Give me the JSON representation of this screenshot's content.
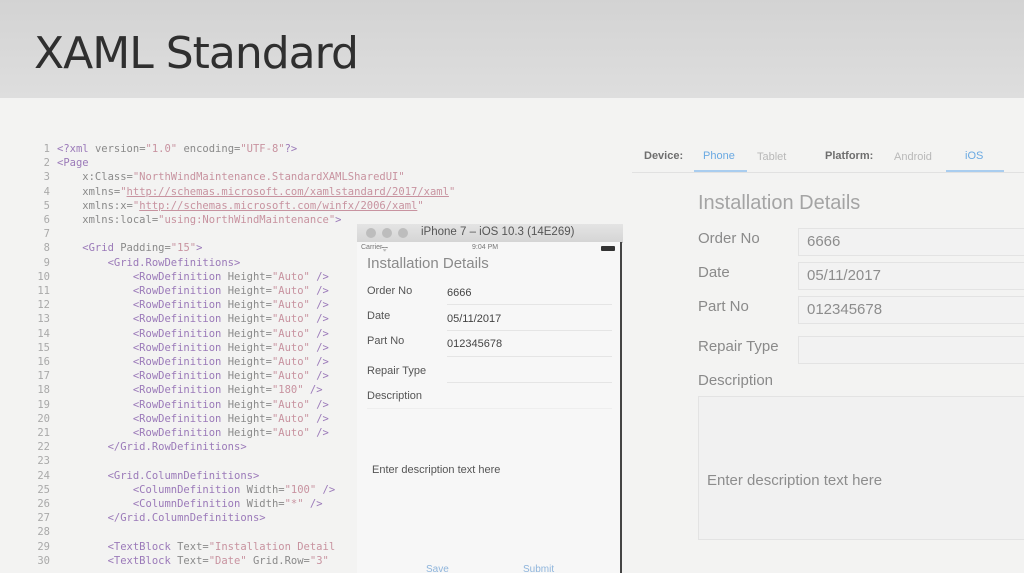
{
  "slide": {
    "title": "XAML Standard"
  },
  "code": {
    "lines": [
      {
        "n": "1",
        "segs": [
          {
            "t": "<?xml ",
            "c": "c-tag"
          },
          {
            "t": "version=",
            "c": "c-attr"
          },
          {
            "t": "\"1.0\"",
            "c": "c-str"
          },
          {
            "t": " encoding=",
            "c": "c-attr"
          },
          {
            "t": "\"UTF-8\"",
            "c": "c-str"
          },
          {
            "t": "?>",
            "c": "c-tag"
          }
        ]
      },
      {
        "n": "2",
        "segs": [
          {
            "t": "<Page",
            "c": "c-tag"
          }
        ]
      },
      {
        "n": "3",
        "segs": [
          {
            "t": "    x:Class=",
            "c": "c-attr"
          },
          {
            "t": "\"NorthWindMaintenance.StandardXAMLSharedUI\"",
            "c": "c-str"
          }
        ]
      },
      {
        "n": "4",
        "segs": [
          {
            "t": "    xmlns=",
            "c": "c-attr"
          },
          {
            "t": "\"",
            "c": "c-str"
          },
          {
            "t": "http://schemas.microsoft.com/xamlstandard/2017/xaml",
            "c": "c-link"
          },
          {
            "t": "\"",
            "c": "c-str"
          }
        ]
      },
      {
        "n": "5",
        "segs": [
          {
            "t": "    xmlns:x=",
            "c": "c-attr"
          },
          {
            "t": "\"",
            "c": "c-str"
          },
          {
            "t": "http://schemas.microsoft.com/winfx/2006/xaml",
            "c": "c-link"
          },
          {
            "t": "\"",
            "c": "c-str"
          }
        ]
      },
      {
        "n": "6",
        "segs": [
          {
            "t": "    xmlns:local=",
            "c": "c-attr"
          },
          {
            "t": "\"using:NorthWindMaintenance\"",
            "c": "c-str"
          },
          {
            "t": ">",
            "c": "c-tag"
          }
        ]
      },
      {
        "n": "7",
        "segs": []
      },
      {
        "n": "8",
        "segs": [
          {
            "t": "    <Grid ",
            "c": "c-tag"
          },
          {
            "t": "Padding=",
            "c": "c-attr"
          },
          {
            "t": "\"15\"",
            "c": "c-str"
          },
          {
            "t": ">",
            "c": "c-tag"
          }
        ]
      },
      {
        "n": "9",
        "segs": [
          {
            "t": "        <Grid.RowDefinitions>",
            "c": "c-tag"
          }
        ]
      },
      {
        "n": "10",
        "segs": [
          {
            "t": "            <RowDefinition ",
            "c": "c-tag"
          },
          {
            "t": "Height=",
            "c": "c-attr"
          },
          {
            "t": "\"Auto\"",
            "c": "c-str"
          },
          {
            "t": " />",
            "c": "c-tag"
          }
        ]
      },
      {
        "n": "11",
        "segs": [
          {
            "t": "            <RowDefinition ",
            "c": "c-tag"
          },
          {
            "t": "Height=",
            "c": "c-attr"
          },
          {
            "t": "\"Auto\"",
            "c": "c-str"
          },
          {
            "t": " />",
            "c": "c-tag"
          }
        ]
      },
      {
        "n": "12",
        "segs": [
          {
            "t": "            <RowDefinition ",
            "c": "c-tag"
          },
          {
            "t": "Height=",
            "c": "c-attr"
          },
          {
            "t": "\"Auto\"",
            "c": "c-str"
          },
          {
            "t": " />",
            "c": "c-tag"
          }
        ]
      },
      {
        "n": "13",
        "segs": [
          {
            "t": "            <RowDefinition ",
            "c": "c-tag"
          },
          {
            "t": "Height=",
            "c": "c-attr"
          },
          {
            "t": "\"Auto\"",
            "c": "c-str"
          },
          {
            "t": " />",
            "c": "c-tag"
          }
        ]
      },
      {
        "n": "14",
        "segs": [
          {
            "t": "            <RowDefinition ",
            "c": "c-tag"
          },
          {
            "t": "Height=",
            "c": "c-attr"
          },
          {
            "t": "\"Auto\"",
            "c": "c-str"
          },
          {
            "t": " />",
            "c": "c-tag"
          }
        ]
      },
      {
        "n": "15",
        "segs": [
          {
            "t": "            <RowDefinition ",
            "c": "c-tag"
          },
          {
            "t": "Height=",
            "c": "c-attr"
          },
          {
            "t": "\"Auto\"",
            "c": "c-str"
          },
          {
            "t": " />",
            "c": "c-tag"
          }
        ]
      },
      {
        "n": "16",
        "segs": [
          {
            "t": "            <RowDefinition ",
            "c": "c-tag"
          },
          {
            "t": "Height=",
            "c": "c-attr"
          },
          {
            "t": "\"Auto\"",
            "c": "c-str"
          },
          {
            "t": " />",
            "c": "c-tag"
          }
        ]
      },
      {
        "n": "17",
        "segs": [
          {
            "t": "            <RowDefinition ",
            "c": "c-tag"
          },
          {
            "t": "Height=",
            "c": "c-attr"
          },
          {
            "t": "\"Auto\"",
            "c": "c-str"
          },
          {
            "t": " />",
            "c": "c-tag"
          }
        ]
      },
      {
        "n": "18",
        "segs": [
          {
            "t": "            <RowDefinition ",
            "c": "c-tag"
          },
          {
            "t": "Height=",
            "c": "c-attr"
          },
          {
            "t": "\"180\"",
            "c": "c-str"
          },
          {
            "t": " />",
            "c": "c-tag"
          }
        ]
      },
      {
        "n": "19",
        "segs": [
          {
            "t": "            <RowDefinition ",
            "c": "c-tag"
          },
          {
            "t": "Height=",
            "c": "c-attr"
          },
          {
            "t": "\"Auto\"",
            "c": "c-str"
          },
          {
            "t": " />",
            "c": "c-tag"
          }
        ]
      },
      {
        "n": "20",
        "segs": [
          {
            "t": "            <RowDefinition ",
            "c": "c-tag"
          },
          {
            "t": "Height=",
            "c": "c-attr"
          },
          {
            "t": "\"Auto\"",
            "c": "c-str"
          },
          {
            "t": " />",
            "c": "c-tag"
          }
        ]
      },
      {
        "n": "21",
        "segs": [
          {
            "t": "            <RowDefinition ",
            "c": "c-tag"
          },
          {
            "t": "Height=",
            "c": "c-attr"
          },
          {
            "t": "\"Auto\"",
            "c": "c-str"
          },
          {
            "t": " />",
            "c": "c-tag"
          }
        ]
      },
      {
        "n": "22",
        "segs": [
          {
            "t": "        </Grid.RowDefinitions>",
            "c": "c-tag"
          }
        ]
      },
      {
        "n": "23",
        "segs": []
      },
      {
        "n": "24",
        "segs": [
          {
            "t": "        <Grid.ColumnDefinitions>",
            "c": "c-tag"
          }
        ]
      },
      {
        "n": "25",
        "segs": [
          {
            "t": "            <ColumnDefinition ",
            "c": "c-tag"
          },
          {
            "t": "Width=",
            "c": "c-attr"
          },
          {
            "t": "\"100\"",
            "c": "c-str"
          },
          {
            "t": " />",
            "c": "c-tag"
          }
        ]
      },
      {
        "n": "26",
        "segs": [
          {
            "t": "            <ColumnDefinition ",
            "c": "c-tag"
          },
          {
            "t": "Width=",
            "c": "c-attr"
          },
          {
            "t": "\"*\"",
            "c": "c-str"
          },
          {
            "t": " />",
            "c": "c-tag"
          }
        ]
      },
      {
        "n": "27",
        "segs": [
          {
            "t": "        </Grid.ColumnDefinitions>",
            "c": "c-tag"
          }
        ]
      },
      {
        "n": "28",
        "segs": []
      },
      {
        "n": "29",
        "segs": [
          {
            "t": "        <TextBlock ",
            "c": "c-tag"
          },
          {
            "t": "Text=",
            "c": "c-attr"
          },
          {
            "t": "\"Installation Detail",
            "c": "c-str"
          }
        ]
      },
      {
        "n": "30",
        "segs": [
          {
            "t": "        <TextBlock ",
            "c": "c-tag"
          },
          {
            "t": "Text=",
            "c": "c-attr"
          },
          {
            "t": "\"Date\"",
            "c": "c-str"
          },
          {
            "t": " Grid.Row=",
            "c": "c-attr"
          },
          {
            "t": "\"3\"",
            "c": "c-str"
          }
        ]
      }
    ]
  },
  "designer": {
    "device_label": "Device:",
    "device_options": [
      "Phone",
      "Tablet"
    ],
    "device_selected": "Phone",
    "platform_label": "Platform:",
    "platform_options": [
      "Android",
      "iOS"
    ],
    "platform_selected": "iOS",
    "form_title": "Installation Details",
    "fields": [
      {
        "label": "Order No",
        "value": "6666"
      },
      {
        "label": "Date",
        "value": "05/11/2017"
      },
      {
        "label": "Part No",
        "value": "012345678"
      },
      {
        "label": "Repair Type",
        "value": ""
      }
    ],
    "description_label": "Description",
    "description_placeholder": "Enter description text here"
  },
  "simulator": {
    "window_title": "iPhone 7 – iOS 10.3 (14E269)",
    "carrier": "Carrier",
    "time": "9:04 PM",
    "form_title": "Installation Details",
    "fields": [
      {
        "label": "Order No",
        "value": "6666"
      },
      {
        "label": "Date",
        "value": "05/11/2017"
      },
      {
        "label": "Part No",
        "value": "012345678"
      },
      {
        "label": "Repair Type",
        "value": ""
      },
      {
        "label": "Description",
        "value": ""
      }
    ],
    "description_placeholder": "Enter description text here",
    "save_label": "Save",
    "submit_label": "Submit"
  },
  "colors": {
    "tag": "#9b7ab9",
    "string": "#c893a0",
    "accent": "#6aa9e2"
  }
}
